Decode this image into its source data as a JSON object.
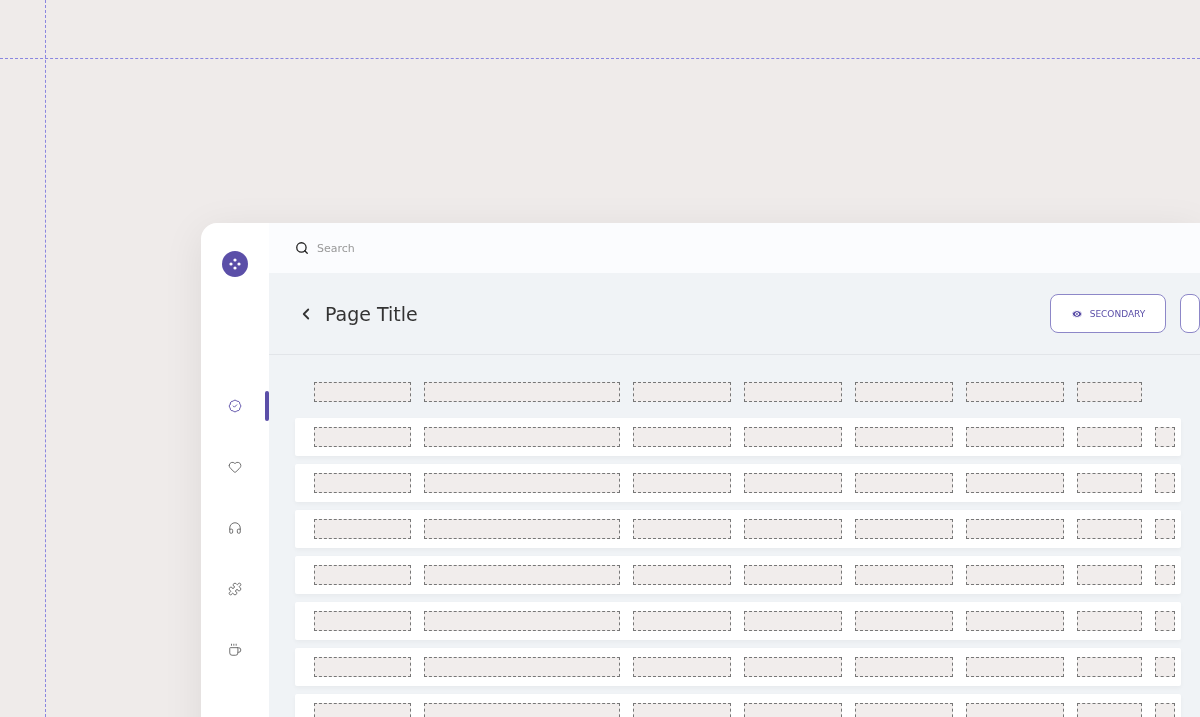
{
  "sidebar": {
    "items": [
      {
        "selected": true
      },
      {
        "selected": false
      },
      {
        "selected": false
      },
      {
        "selected": false
      },
      {
        "selected": false
      }
    ]
  },
  "search": {
    "placeholder": "Search"
  },
  "header": {
    "title": "Page Title",
    "actions": [
      {
        "kind": "outline",
        "label": "SECONDARY"
      },
      {
        "kind": "outline-cut"
      }
    ]
  },
  "table": {
    "header": {
      "kind": "placeholder"
    },
    "rows": [
      {
        "kind": "placeholder"
      },
      {
        "kind": "placeholder"
      },
      {
        "kind": "placeholder"
      },
      {
        "kind": "placeholder"
      },
      {
        "kind": "placeholder"
      },
      {
        "kind": "placeholder"
      },
      {
        "kind": "placeholder"
      }
    ]
  }
}
